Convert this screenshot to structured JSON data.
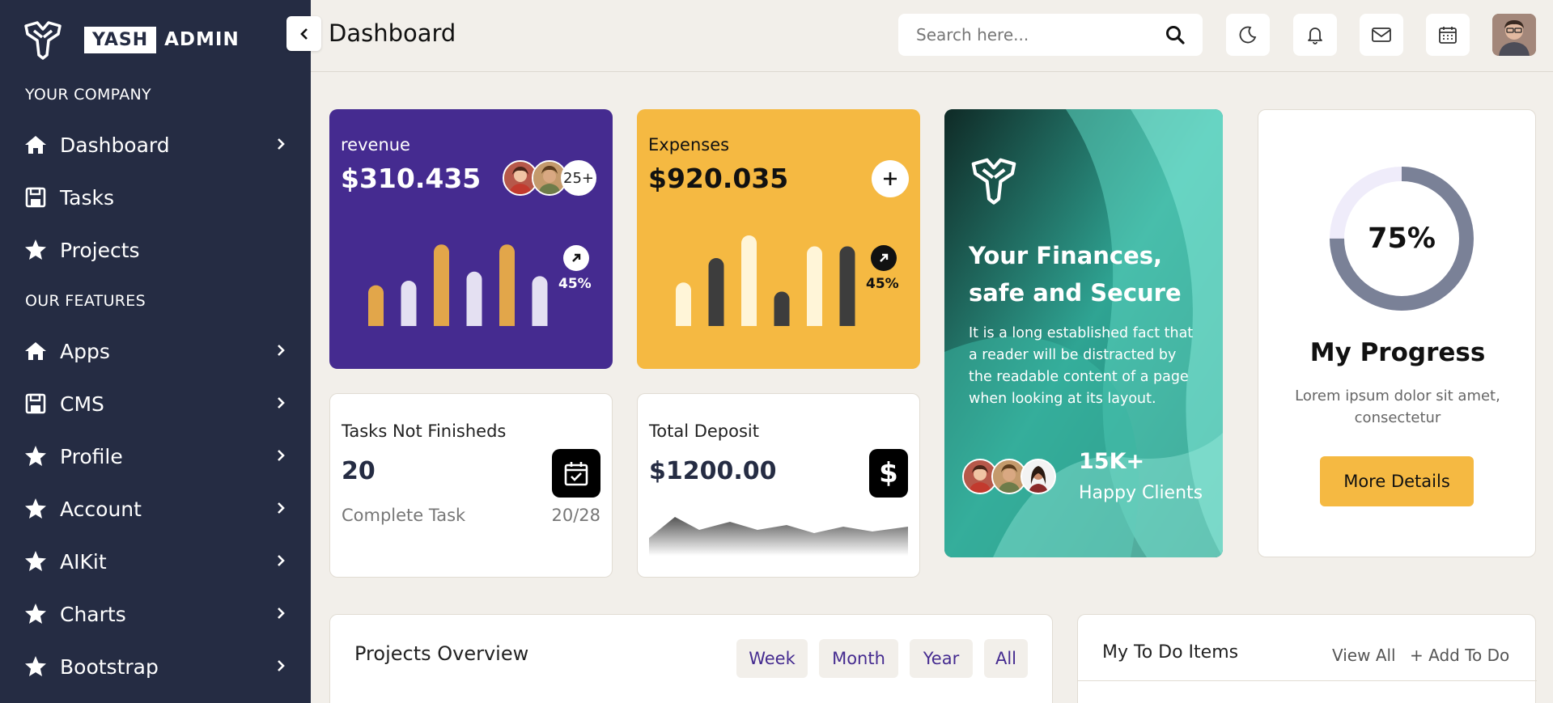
{
  "brand": {
    "name_boxed": "YASH",
    "name_plain": "ADMIN"
  },
  "sidebar": {
    "section1": "YOUR COMPANY",
    "section2": "OUR FEATURES",
    "items": [
      {
        "label": "Dashboard",
        "icon": "home-icon",
        "has_chevron": true
      },
      {
        "label": "Tasks",
        "icon": "floppy-icon",
        "has_chevron": false
      },
      {
        "label": "Projects",
        "icon": "star-icon",
        "has_chevron": false
      },
      {
        "label": "Apps",
        "icon": "home-icon",
        "has_chevron": true
      },
      {
        "label": "CMS",
        "icon": "floppy-icon",
        "has_chevron": true
      },
      {
        "label": "Profile",
        "icon": "star-icon",
        "has_chevron": true
      },
      {
        "label": "Account",
        "icon": "star-icon",
        "has_chevron": true
      },
      {
        "label": "AIKit",
        "icon": "star-icon",
        "has_chevron": true
      },
      {
        "label": "Charts",
        "icon": "star-icon",
        "has_chevron": true
      },
      {
        "label": "Bootstrap",
        "icon": "star-icon",
        "has_chevron": true
      }
    ]
  },
  "header": {
    "title": "Dashboard",
    "search_placeholder": "Search here...",
    "icons": [
      "moon-icon",
      "bell-icon",
      "mail-icon",
      "calendar-icon"
    ]
  },
  "revenue": {
    "label": "revenue",
    "value": "$310.435",
    "more_count": "25+",
    "percent": "45%",
    "bars": [
      0.45,
      0.5,
      0.9,
      0.6,
      0.9,
      0.55
    ],
    "bar_colors": [
      "#e2a64a",
      "#e4e0f2",
      "#e2a64a",
      "#e4e0f2",
      "#e2a64a",
      "#e4e0f2"
    ]
  },
  "expenses": {
    "label": "Expenses",
    "value": "$920.035",
    "percent": "45%",
    "bars": [
      0.48,
      0.75,
      1.0,
      0.38,
      0.88,
      0.88
    ],
    "bar_colors": [
      "#fff5d8",
      "#3d3d3d",
      "#fff5d8",
      "#3d3d3d",
      "#fff5d8",
      "#3d3d3d"
    ]
  },
  "tasks_card": {
    "label": "Tasks Not Finisheds",
    "value": "20",
    "sub": "Complete Task",
    "fraction": "20/28"
  },
  "deposit_card": {
    "label": "Total Deposit",
    "value": "$1200.00"
  },
  "promo": {
    "title": "Your Finances, safe and Secure",
    "text": "It is a long established fact that a reader will be distracted by the readable content of a page when looking at its layout.",
    "count": "15K+",
    "count_label": "Happy Clients"
  },
  "progress": {
    "value": 0.75,
    "label": "75%",
    "title": "My Progress",
    "text": "Lorem ipsum dolor sit amet, consectetur",
    "button": "More Details"
  },
  "overview": {
    "title": "Projects Overview",
    "filters": [
      "Week",
      "Month",
      "Year",
      "All"
    ]
  },
  "todo": {
    "title": "My To Do Items",
    "view_all": "View All",
    "add": "+ Add To Do"
  },
  "colors": {
    "sidebar": "#252c43",
    "revenue": "#452b90",
    "expenses": "#f5b942",
    "accent": "#f5b942",
    "background": "#f2efea"
  }
}
